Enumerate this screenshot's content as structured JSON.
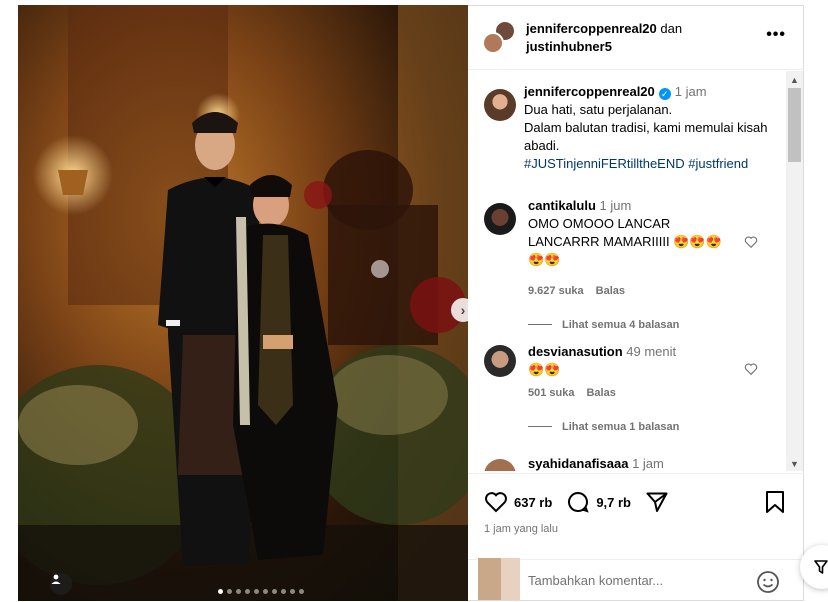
{
  "header": {
    "user1": "jennifercoppenreal20",
    "connector": "dan",
    "user2": "justinhubner5",
    "more_label": "•••"
  },
  "caption": {
    "username": "jennifercoppenreal20",
    "verified_mark": "✓",
    "time": "1 jam",
    "line1": "Dua hati, satu perjalanan.",
    "line2": "Dalam balutan tradisi, kami memulai kisah abadi.",
    "hashtag1": "#JUSTinjenniFERtilltheEND",
    "hashtag2": "#justfriend"
  },
  "comments": [
    {
      "username": "cantikalulu",
      "time": "1 jum",
      "text": "OMO OMOOO LANCAR LANCARRR MAMARIIIII 😍😍😍😍😍",
      "likes": "9.627 suka",
      "reply": "Balas",
      "view_replies": "Lihat semua 4 balasan"
    },
    {
      "username": "desvianasution",
      "time": "49 menit",
      "text": "😍😍",
      "likes": "501 suka",
      "reply": "Balas",
      "view_replies": "Lihat semua 1 balasan"
    },
    {
      "username": "syahidanafisaaa",
      "time": "1 jam"
    }
  ],
  "actions": {
    "likes_count": "637 rb",
    "comments_count": "9,7 rb",
    "posted_ago": "1 jam yang lalu"
  },
  "add_comment": {
    "placeholder": "Tambahkan komentar..."
  },
  "carousel": {
    "dot_count": 10,
    "active_index": 0
  },
  "colors": {
    "link": "#00376b",
    "verified": "#0095f6",
    "meta": "#737373"
  }
}
